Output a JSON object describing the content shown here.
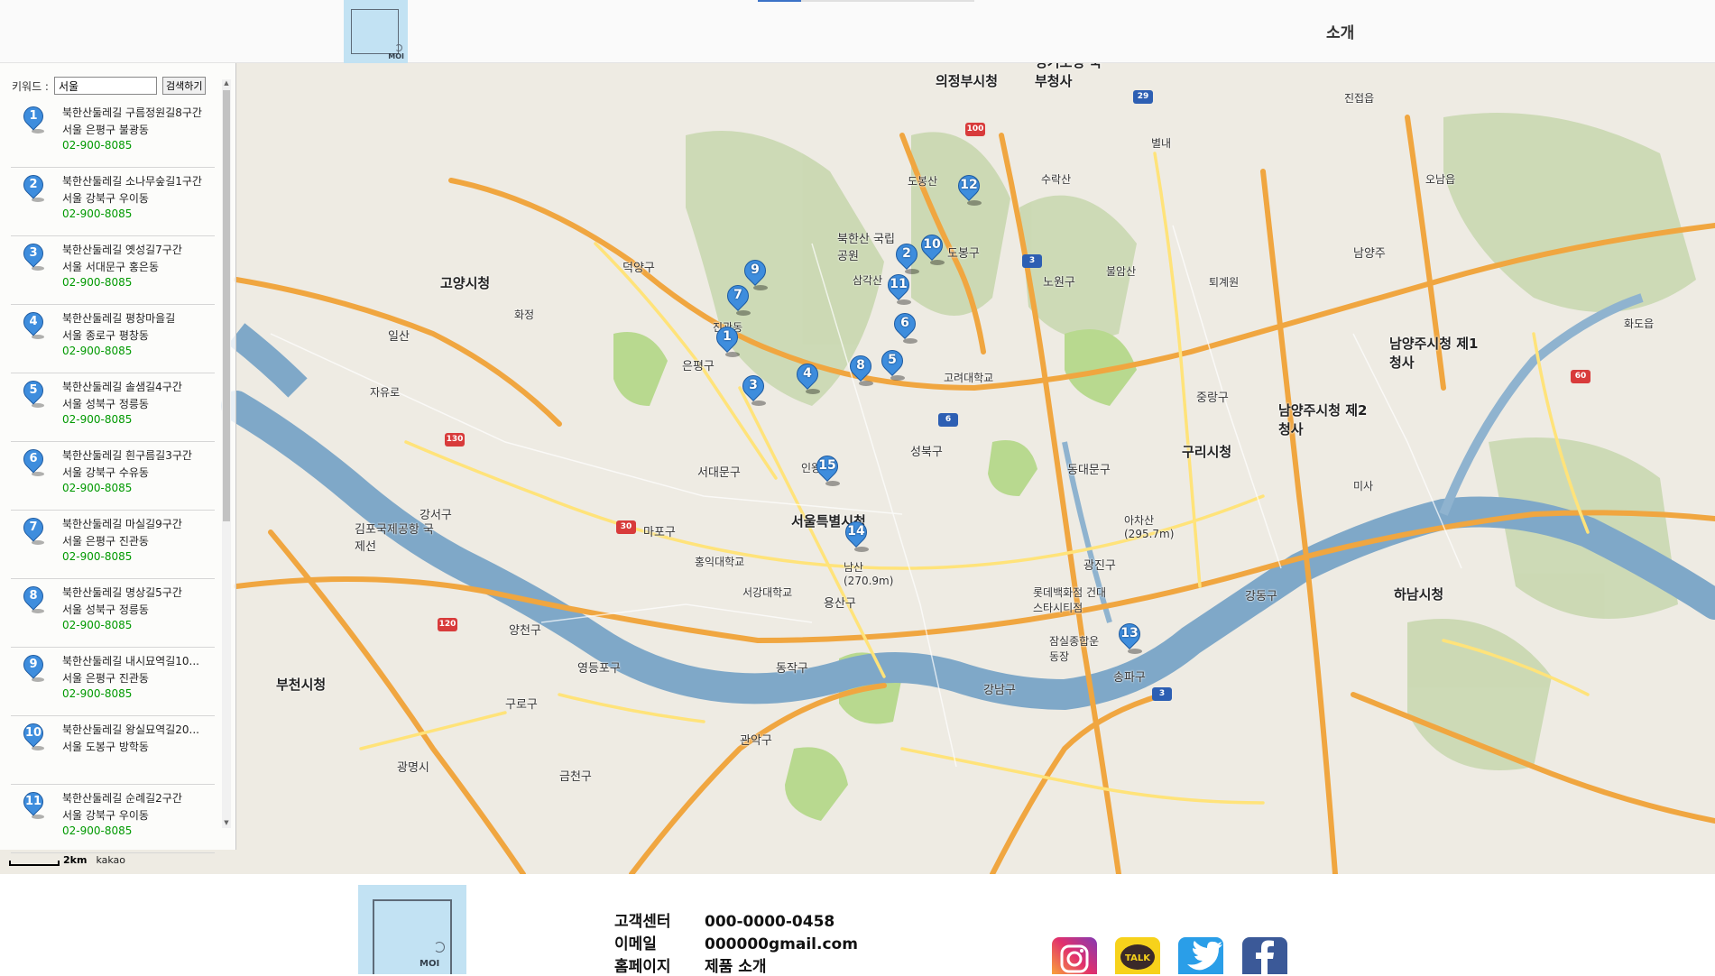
{
  "header": {
    "logo_text": "MOI",
    "nav_about": "소개"
  },
  "search": {
    "label": "키워드 :",
    "value": "서울",
    "button": "검색하기"
  },
  "places": [
    {
      "num": "1",
      "name": "북한산둘레길 구름정원길8구간",
      "addr": "서울 은평구 불광동",
      "tel": "02-900-8085"
    },
    {
      "num": "2",
      "name": "북한산둘레길 소나무숲길1구간",
      "addr": "서울 강북구 우이동",
      "tel": "02-900-8085"
    },
    {
      "num": "3",
      "name": "북한산둘레길 옛성길7구간",
      "addr": "서울 서대문구 홍은동",
      "tel": "02-900-8085"
    },
    {
      "num": "4",
      "name": "북한산둘레길 평창마을길",
      "addr": "서울 종로구 평창동",
      "tel": "02-900-8085"
    },
    {
      "num": "5",
      "name": "북한산둘레길 솔샘길4구간",
      "addr": "서울 성북구 정릉동",
      "tel": "02-900-8085"
    },
    {
      "num": "6",
      "name": "북한산둘레길 흰구름길3구간",
      "addr": "서울 강북구 수유동",
      "tel": "02-900-8085"
    },
    {
      "num": "7",
      "name": "북한산둘레길 마실길9구간",
      "addr": "서울 은평구 진관동",
      "tel": "02-900-8085"
    },
    {
      "num": "8",
      "name": "북한산둘레길 명상길5구간",
      "addr": "서울 성북구 정릉동",
      "tel": "02-900-8085"
    },
    {
      "num": "9",
      "name": "북한산둘레길 내시묘역길10...",
      "addr": "서울 은평구 진관동",
      "tel": "02-900-8085"
    },
    {
      "num": "10",
      "name": "북한산둘레길 왕실묘역길20...",
      "addr": "서울 도봉구 방학동",
      "tel": ""
    },
    {
      "num": "11",
      "name": "북한산둘레길 순례길2구간",
      "addr": "서울 강북구 우이동",
      "tel": "02-900-8085"
    }
  ],
  "map": {
    "scale_label": "2km",
    "brand": "kakao",
    "markers": [
      "1",
      "2",
      "3",
      "4",
      "5",
      "6",
      "7",
      "8",
      "9",
      "10",
      "11",
      "12",
      "13",
      "14",
      "15"
    ],
    "place_labels": {
      "goyang": "고양시청",
      "uijeongbu": "의정부시청",
      "seoul": "서울특별시청",
      "guri": "구리시청",
      "namyangju2": "남양주시청 제2청사",
      "namyangju1": "남양주시청 제1청사",
      "hanam": "하남시청",
      "bucheon": "부천시청",
      "bukbu": "경기도청 북부청사",
      "gimpo_airport": "김포국제공항 국제선",
      "bukhansan": "북한산 국립공원",
      "namsan": "남산 (270.9m)",
      "dobongsan": "도봉산",
      "suraksan": "수락산",
      "buramsan": "불암산",
      "yongmasan": "아차산 (295.7m)",
      "seodaemun": "서대문구",
      "seongbuk": "성북구",
      "gwangjin": "광진구",
      "songpa": "송파구",
      "gangnam": "강남구",
      "yongsan": "용산구",
      "mapo": "마포구",
      "yangcheon": "양천구",
      "gangseo": "강서구",
      "eunpyeong": "은평구",
      "jungnang": "중랑구",
      "dongdaemun": "동대문구",
      "nowon": "노원구",
      "dobong": "도봉구",
      "jamsil": "잠실종합운동장",
      "lotte": "롯데백화점 건대스타시티점",
      "hongik": "홍익대학교",
      "korea_univ": "고려대학교",
      "sogang": "서강대학교",
      "jingwan": "진관동",
      "samgaksan": "삼각산",
      "inwangsan": "인왕산",
      "ilsan": "일산",
      "jayuro": "자유로",
      "hwajeong": "화정",
      "deogyang": "덕양구",
      "toegyewon": "퇴계원",
      "namyangju": "남양주",
      "jinjeop": "진접읍",
      "onam": "오남읍",
      "byeollae": "별내",
      "hwado": "화도읍",
      "misa": "미사",
      "gangdong": "강동구",
      "gwangmyeong": "광명시",
      "geumcheon": "금천구",
      "gwanak": "관악구",
      "dongjak": "동작구",
      "yeongdeungpo": "영등포구",
      "guro": "구로구"
    }
  },
  "footer": {
    "logo_text": "MOI",
    "rows": [
      {
        "key": "고객센터",
        "value": "000-0000-0458"
      },
      {
        "key": "이메일",
        "value": "000000gmail.com"
      },
      {
        "key": "홈페이지",
        "value": "제품 소개"
      }
    ],
    "kakao_label": "TALK"
  },
  "colors": {
    "marker": "#3e8ddd",
    "river": "#7fa8c8",
    "park": "#b8d98f",
    "highway": "#f0a640",
    "road": "#ffe37a",
    "tel": "#009900"
  }
}
